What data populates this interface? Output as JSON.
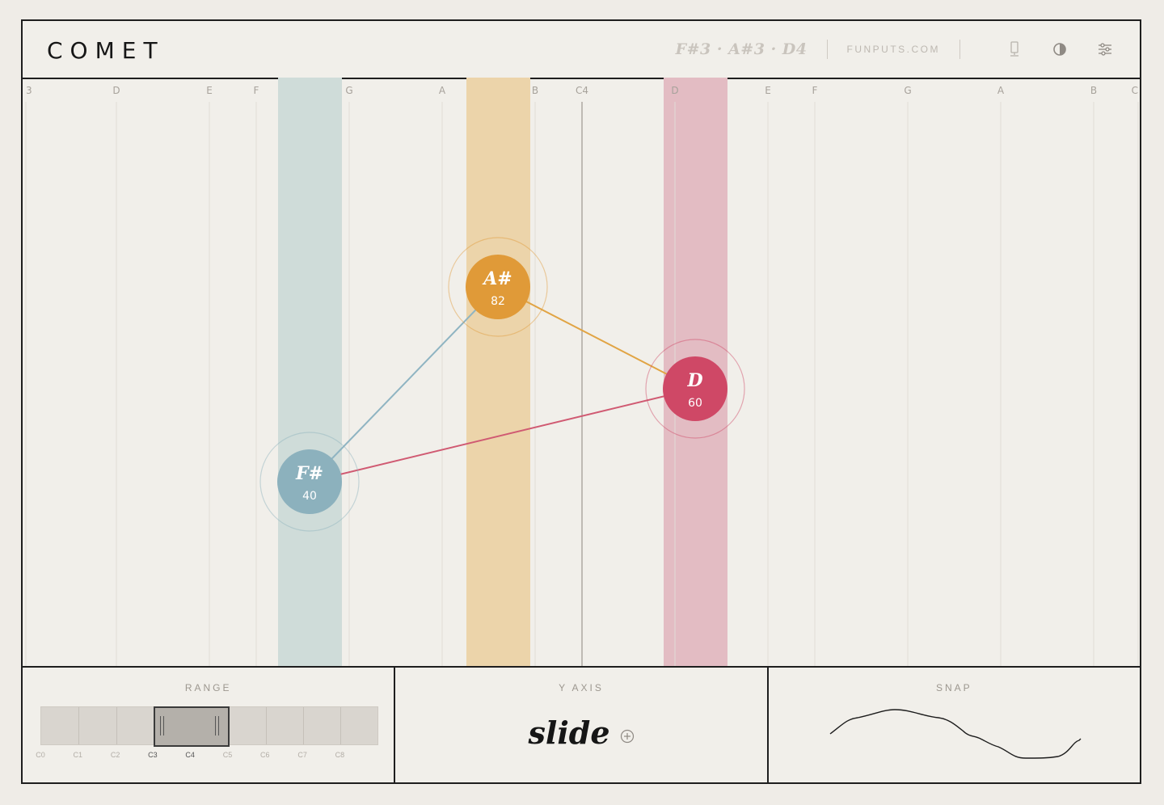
{
  "app": {
    "title": "COMET"
  },
  "header": {
    "chord": "F#3 · A#3 · D4",
    "site": "FUNPUTS.COM",
    "icons": [
      "midi-device-icon",
      "contrast-icon",
      "settings-sliders-icon"
    ]
  },
  "keyboard": {
    "labels": [
      "3",
      "D",
      "E",
      "F",
      "G",
      "A",
      "B",
      "C4",
      "D",
      "E",
      "F",
      "G",
      "A",
      "B",
      "C"
    ]
  },
  "notes": [
    {
      "name": "F#",
      "velocity": "40",
      "color": "#8cb1bd",
      "band": "#cfdcd9",
      "line": "#8fb4c2"
    },
    {
      "name": "A#",
      "velocity": "82",
      "color": "#e09a38",
      "band": "#ecd4aa",
      "line": "#e1a444"
    },
    {
      "name": "D",
      "velocity": "60",
      "color": "#cf4866",
      "band": "#e3bcc3",
      "line": "#d05a72"
    }
  ],
  "panels": {
    "range": {
      "title": "RANGE",
      "octaves": [
        "C0",
        "C1",
        "C2",
        "C3",
        "C4",
        "C5",
        "C6",
        "C7",
        "C8"
      ],
      "active": [
        "C3",
        "C4"
      ]
    },
    "yaxis": {
      "title": "Y AXIS",
      "value": "slide"
    },
    "snap": {
      "title": "SNAP"
    }
  }
}
